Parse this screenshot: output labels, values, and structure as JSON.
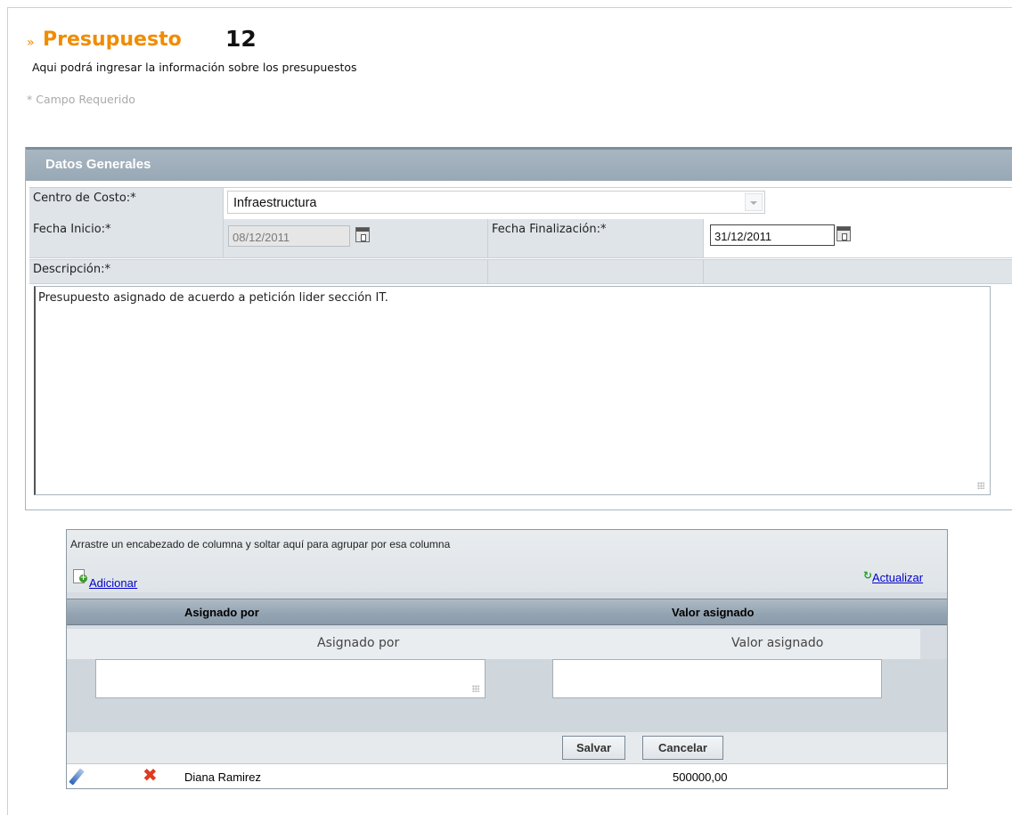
{
  "header": {
    "chevron": "»",
    "title": "Presupuesto",
    "number": "12",
    "subtitle": "Aqui podrá ingresar la información sobre los presupuestos",
    "required_note": "* Campo Requerido"
  },
  "general": {
    "section_title": "Datos Generales",
    "cost_center_label": "Centro de Costo:*",
    "cost_center_value": "Infraestructura",
    "start_date_label": "Fecha Inicio:*",
    "start_date_value": "08/12/2011",
    "end_date_label": "Fecha Finalización:*",
    "end_date_value": "31/12/2011",
    "description_label": "Descripción:*",
    "description_value": "Presupuesto asignado de acuerdo a petición lider sección IT."
  },
  "grid": {
    "group_hint": "Arrastre un encabezado de columna y soltar aquí para agrupar por esa columna",
    "add_label": "Adicionar",
    "refresh_label": "Actualizar",
    "columns": [
      "Asignado por",
      "Valor asignado"
    ],
    "edit_labels": [
      "Asignado por",
      "Valor asignado"
    ],
    "save_label": "Salvar",
    "cancel_label": "Cancelar",
    "rows": [
      {
        "assigned_by": "Diana Ramirez",
        "value": "500000,00"
      }
    ]
  },
  "colors": {
    "accent": "#f08c00",
    "header_bar": "#98a8b5",
    "link": "#0000cc"
  },
  "icons": [
    "calendar-icon",
    "add-document-icon",
    "refresh-icon",
    "edit-pencil-icon",
    "delete-x-icon",
    "dropdown-arrow-icon",
    "resize-grip-icon"
  ]
}
